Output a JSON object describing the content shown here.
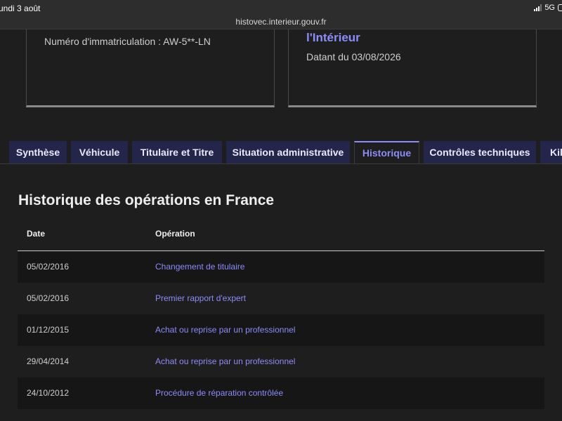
{
  "status": {
    "time": "undi 3 août",
    "network": "5G"
  },
  "browser": {
    "url": "histovec.interieur.gouv.fr"
  },
  "cards": {
    "left": {
      "plate": "Numéro d'immatriculation : AW-5**-LN"
    },
    "right": {
      "title": "l'Intérieur",
      "date": "Datant du 03/08/2026"
    }
  },
  "tabs": [
    {
      "label": "Synthèse"
    },
    {
      "label": "Véhicule"
    },
    {
      "label": "Titulaire et Titre"
    },
    {
      "label": "Situation administrative"
    },
    {
      "label": "Historique",
      "active": true
    },
    {
      "label": "Contrôles techniques"
    },
    {
      "label": "Kilo"
    }
  ],
  "section": {
    "title": "Historique des opérations en France"
  },
  "table": {
    "headers": {
      "date": "Date",
      "operation": "Opération"
    },
    "rows": [
      {
        "date": "05/02/2016",
        "operation": "Changement de titulaire"
      },
      {
        "date": "05/02/2016",
        "operation": "Premier rapport d'expert"
      },
      {
        "date": "01/12/2015",
        "operation": "Achat ou reprise par un professionnel"
      },
      {
        "date": "29/04/2014",
        "operation": "Achat ou reprise par un professionnel"
      },
      {
        "date": "24/10/2012",
        "operation": "Procédure de réparation contrôlée"
      }
    ]
  },
  "colors": {
    "accent": "#8c8cfa",
    "tab_background": "#23264a",
    "page_background": "#1e1e1e"
  }
}
